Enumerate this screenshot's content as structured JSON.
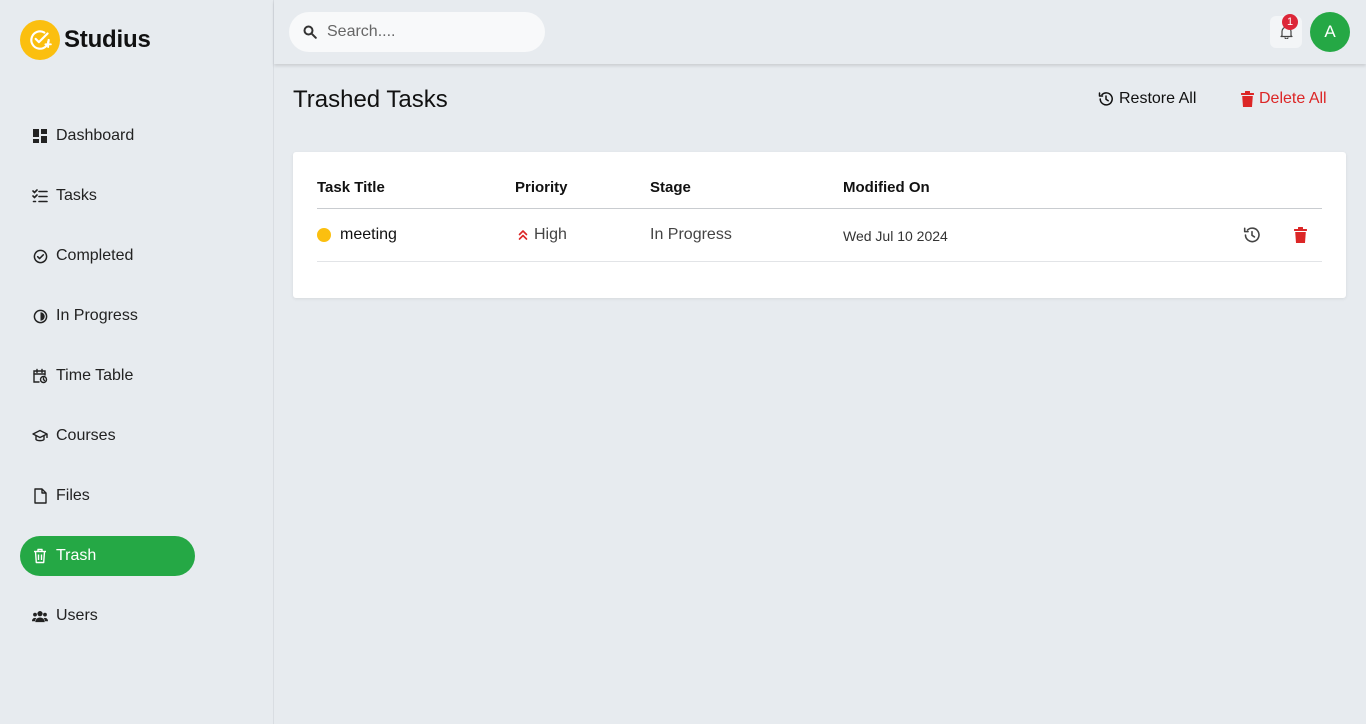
{
  "brand": {
    "name": "Studius",
    "logo_icon": "check-plus-icon",
    "logo_color": "#fbbf0f"
  },
  "sidebar": {
    "items": [
      {
        "label": "Dashboard",
        "icon": "dashboard-icon",
        "active": false
      },
      {
        "label": "Tasks",
        "icon": "task-list-icon",
        "active": false
      },
      {
        "label": "Completed",
        "icon": "check-circle-icon",
        "active": false
      },
      {
        "label": "In Progress",
        "icon": "progress-circle-icon",
        "active": false
      },
      {
        "label": "Time Table",
        "icon": "calendar-clock-icon",
        "active": false
      },
      {
        "label": "Courses",
        "icon": "graduation-cap-icon",
        "active": false
      },
      {
        "label": "Files",
        "icon": "file-icon",
        "active": false
      },
      {
        "label": "Trash",
        "icon": "trash-icon",
        "active": true
      },
      {
        "label": "Users",
        "icon": "users-icon",
        "active": false
      }
    ],
    "active_color": "#25a845"
  },
  "topbar": {
    "search_placeholder": "Search....",
    "notification_count": "1",
    "avatar_initial": "A"
  },
  "main": {
    "title": "Trashed Tasks",
    "restore_all_label": "Restore All",
    "delete_all_label": "Delete All",
    "table": {
      "headers": [
        "Task Title",
        "Priority",
        "Stage",
        "Modified On"
      ],
      "rows": [
        {
          "title": "meeting",
          "dot_color": "#fbbf0f",
          "priority": "High",
          "priority_icon": "double-chevron-up-icon",
          "stage": "In Progress",
          "modified": "Wed Jul 10 2024"
        }
      ]
    }
  },
  "colors": {
    "danger": "#dc2626",
    "success": "#25a845",
    "warning": "#fbbf0f"
  }
}
